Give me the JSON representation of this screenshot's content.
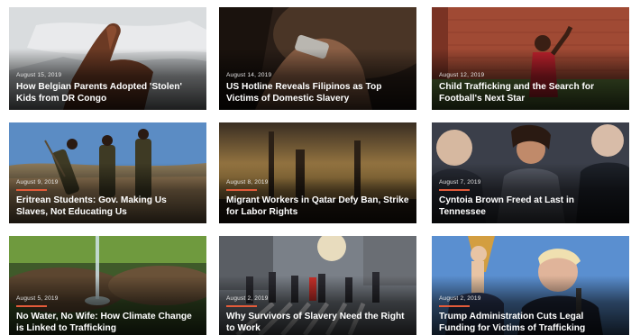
{
  "colors": {
    "accent": "#e35b3a"
  },
  "cards": [
    {
      "date": "August 15, 2019",
      "title": "How Belgian Parents Adopted 'Stolen' Kids from DR Congo",
      "has_bar": false
    },
    {
      "date": "August 14, 2019",
      "title": "US Hotline Reveals Filipinos as Top Victims of Domestic Slavery",
      "has_bar": false
    },
    {
      "date": "August 12, 2019",
      "title": "Child Trafficking and the Search for Football's Next Star",
      "has_bar": false
    },
    {
      "date": "August 9, 2019",
      "title": "Eritrean Students: Gov. Making Us Slaves, Not Educating Us",
      "has_bar": true
    },
    {
      "date": "August 8, 2019",
      "title": "Migrant Workers in Qatar Defy Ban, Strike for Labor Rights",
      "has_bar": true
    },
    {
      "date": "August 7, 2019",
      "title": "Cyntoia Brown Freed at Last in Tennessee",
      "has_bar": true
    },
    {
      "date": "August 5, 2019",
      "title": "No Water, No Wife: How Climate Change is Linked to Trafficking",
      "has_bar": true
    },
    {
      "date": "August 2, 2019",
      "title": "Why Survivors of Slavery Need the Right to Work",
      "has_bar": true
    },
    {
      "date": "August 2, 2019",
      "title": "Trump Administration Cuts Legal Funding for Victims of Trafficking",
      "has_bar": true
    }
  ]
}
